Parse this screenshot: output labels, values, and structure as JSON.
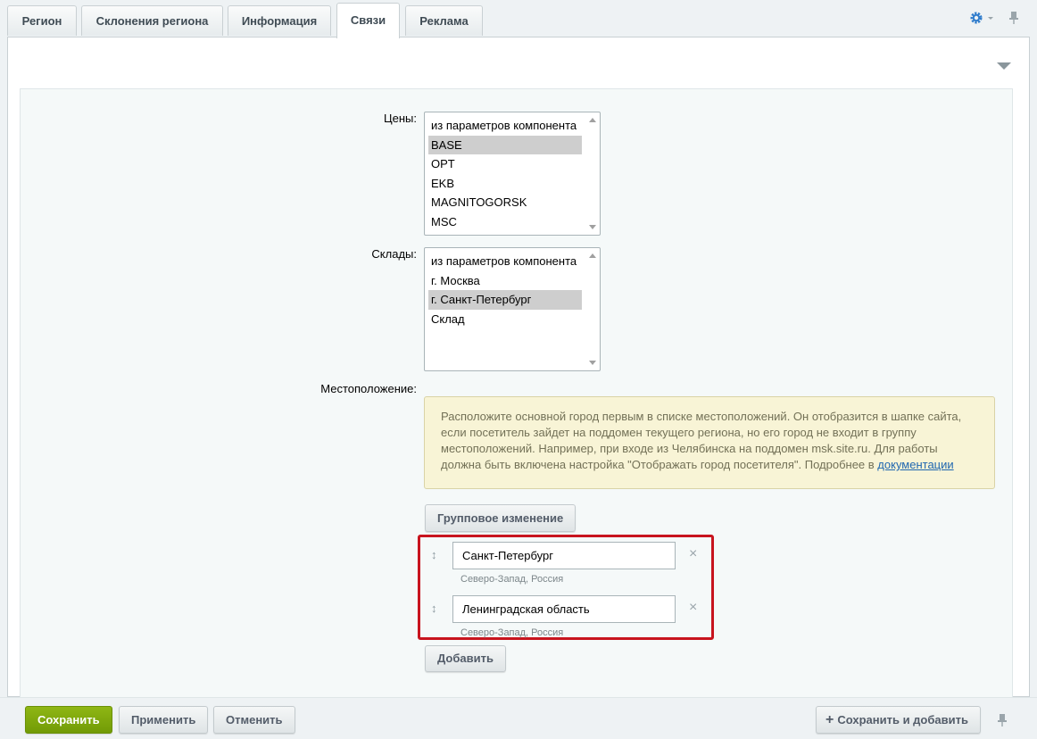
{
  "tabs": [
    {
      "label": "Регион"
    },
    {
      "label": "Склонения региона"
    },
    {
      "label": "Информация"
    },
    {
      "label": "Связи",
      "active": true
    },
    {
      "label": "Реклама"
    }
  ],
  "form": {
    "prices": {
      "label": "Цены:",
      "options": [
        "из параметров компонента",
        "BASE",
        "OPT",
        "EKB",
        "MAGNITOGORSK",
        "MSC"
      ],
      "selected": "BASE"
    },
    "stores": {
      "label": "Склады:",
      "options": [
        "из параметров компонента",
        "г. Москва",
        "г. Санкт-Петербург",
        "Склад"
      ],
      "selected": "г. Санкт-Петербург"
    },
    "location": {
      "label": "Местоположение:",
      "notice_text": "Расположите основной город первым в списке местоположений. Он отобразится в шапке сайта, если посетитель зайдет на поддомен текущего региона, но его город не входит в группу местоположений. Например, при входе из Челябинска на поддомен msk.site.ru. Для работы должна быть включена настройка \"Отображать город посетителя\". Подробнее в ",
      "notice_link": "документации",
      "group_edit_button": "Групповое изменение",
      "items": [
        {
          "value": "Санкт-Петербург",
          "region": "Северо-Запад, Россия"
        },
        {
          "value": "Ленинградская область",
          "region": "Северо-Запад, Россия"
        }
      ],
      "add_button": "Добавить"
    }
  },
  "footer": {
    "save": "Сохранить",
    "apply": "Применить",
    "cancel": "Отменить",
    "save_and_add": "Сохранить и добавить"
  },
  "colors": {
    "save_button": "#7ba60b",
    "highlight_border": "#c8141e",
    "notice_bg": "#f8f4d6",
    "settings_icon": "#2f7ccc"
  }
}
